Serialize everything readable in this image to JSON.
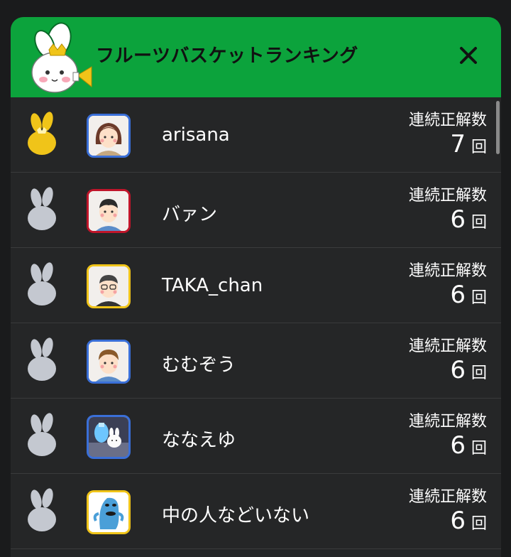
{
  "header": {
    "title": "フルーツバスケットランキング"
  },
  "streak_label": "連続正解数",
  "streak_unit": "回",
  "colors": {
    "header_bg": "#0ca33c",
    "panel_bg": "#252627",
    "gold": "#f0c419",
    "silver": "#c4c8d0"
  },
  "rows": [
    {
      "rank": "1",
      "name": "arisana",
      "count": "7",
      "frame": "#3a6fd8",
      "avatar": "woman-icon"
    },
    {
      "rank": "2",
      "name": "バァン",
      "count": "6",
      "frame": "#c0152a",
      "avatar": "man-icon"
    },
    {
      "rank": "2",
      "name": "TAKA_chan",
      "count": "6",
      "frame": "#f0c419",
      "avatar": "man-glasses-icon"
    },
    {
      "rank": "2",
      "name": "むむぞう",
      "count": "6",
      "frame": "#3a6fd8",
      "avatar": "man-icon"
    },
    {
      "rank": "2",
      "name": "ななえゆ",
      "count": "6",
      "frame": "#3a6fd8",
      "avatar": "photo-icon"
    },
    {
      "rank": "2",
      "name": "中の人などいない",
      "count": "6",
      "frame": "#f0c419",
      "avatar": "blue-creature-icon"
    }
  ]
}
